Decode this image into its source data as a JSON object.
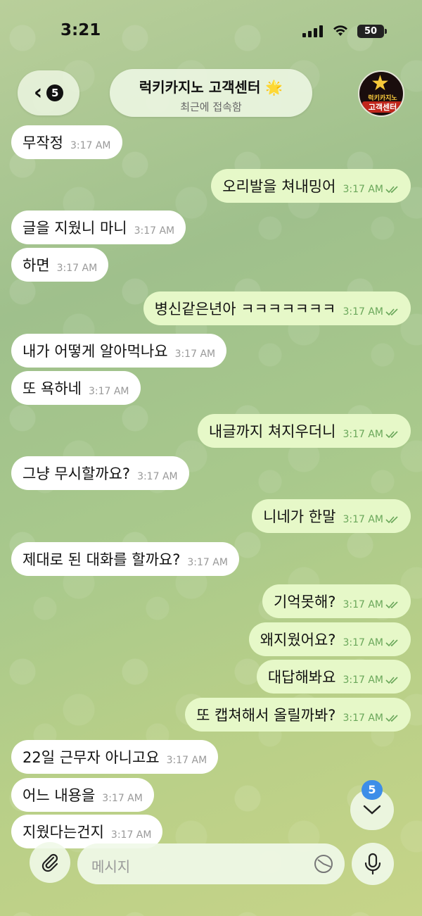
{
  "status_bar": {
    "time": "3:21",
    "battery": "50"
  },
  "header": {
    "back_count": "5",
    "title": "럭키카지노 고객센터 🌟",
    "subtitle": "최근에 접속함",
    "avatar_top": "럭키카지노",
    "avatar_bottom": "고객센터"
  },
  "messages": [
    {
      "dir": "in",
      "text": "무작정",
      "time": "3:17 AM"
    },
    {
      "dir": "out",
      "text": "오리발을 쳐내밍어",
      "time": "3:17 AM"
    },
    {
      "dir": "in",
      "text": "글을 지웠니 마니",
      "time": "3:17 AM"
    },
    {
      "dir": "in",
      "text": "하면",
      "time": "3:17 AM"
    },
    {
      "dir": "out",
      "text": "병신같은년아 ㅋㅋㅋㅋㅋㅋㅋ",
      "time": "3:17 AM"
    },
    {
      "dir": "in",
      "text": "내가 어떻게 알아먹나요",
      "time": "3:17 AM"
    },
    {
      "dir": "in",
      "text": "또 욕하네",
      "time": "3:17 AM"
    },
    {
      "dir": "out",
      "text": "내글까지 쳐지우더니",
      "time": "3:17 AM"
    },
    {
      "dir": "in",
      "text": "그냥 무시할까요?",
      "time": "3:17 AM"
    },
    {
      "dir": "out",
      "text": "니네가 한말",
      "time": "3:17 AM"
    },
    {
      "dir": "in",
      "text": "제대로 된 대화를 할까요?",
      "time": "3:17 AM"
    },
    {
      "dir": "out",
      "text": "기억못해?",
      "time": "3:17 AM"
    },
    {
      "dir": "out",
      "text": "왜지웠어요?",
      "time": "3:17 AM"
    },
    {
      "dir": "out",
      "text": "대답해봐요",
      "time": "3:17 AM"
    },
    {
      "dir": "out",
      "text": "또 캡쳐해서 올릴까봐?",
      "time": "3:17 AM"
    },
    {
      "dir": "in",
      "text": "22일 근무자 아니고요",
      "time": "3:17 AM"
    },
    {
      "dir": "in",
      "text": "어느 내용을",
      "time": "3:17 AM"
    },
    {
      "dir": "in",
      "text": "지웠다는건지",
      "time": "3:17 AM"
    }
  ],
  "composer": {
    "placeholder": "메시지"
  },
  "scroll_badge": "5"
}
